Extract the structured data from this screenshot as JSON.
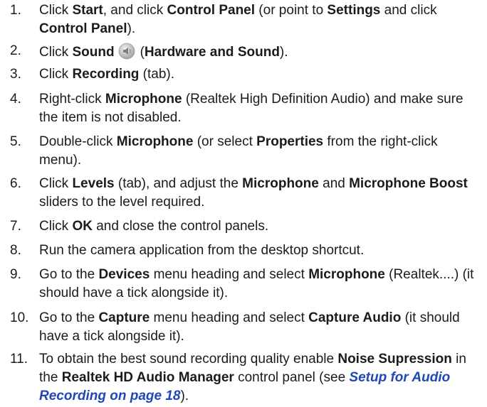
{
  "steps": [
    {
      "num": "1.",
      "parts": [
        {
          "t": "Click "
        },
        {
          "b": "Start"
        },
        {
          "t": ", and click "
        },
        {
          "b": "Control Panel"
        },
        {
          "t": " (or point to "
        },
        {
          "b": "Settings"
        },
        {
          "t": " and click "
        },
        {
          "b": "Control Panel"
        },
        {
          "t": ")."
        }
      ]
    },
    {
      "num": "2.",
      "parts": [
        {
          "t": "Click "
        },
        {
          "b": "Sound"
        },
        {
          "icon": "speaker-icon"
        },
        {
          "t": "("
        },
        {
          "b": "Hardware and Sound"
        },
        {
          "t": ")."
        }
      ]
    },
    {
      "num": "3.",
      "parts": [
        {
          "t": "Click "
        },
        {
          "b": "Recording"
        },
        {
          "t": " (tab)."
        }
      ]
    },
    {
      "num": "4.",
      "parts": [
        {
          "t": "Right-click "
        },
        {
          "b": "Microphone"
        },
        {
          "t": " (Realtek High Definition Audio) and make sure the item is not disabled."
        }
      ]
    },
    {
      "num": "5.",
      "parts": [
        {
          "t": "Double-click "
        },
        {
          "b": "Microphone"
        },
        {
          "t": " (or select "
        },
        {
          "b": "Properties"
        },
        {
          "t": " from the right-click menu)."
        }
      ]
    },
    {
      "num": "6.",
      "parts": [
        {
          "t": "Click "
        },
        {
          "b": "Levels"
        },
        {
          "t": " (tab), and adjust the "
        },
        {
          "b": "Microphone"
        },
        {
          "t": " and "
        },
        {
          "b": "Microphone Boost"
        },
        {
          "t": " sliders to the level required."
        }
      ]
    },
    {
      "num": "7.",
      "parts": [
        {
          "t": "Click "
        },
        {
          "b": "OK"
        },
        {
          "t": " and close the control panels."
        }
      ]
    },
    {
      "num": "8.",
      "parts": [
        {
          "t": "Run the camera application from the desktop shortcut."
        }
      ]
    },
    {
      "num": "9.",
      "parts": [
        {
          "t": "Go to the "
        },
        {
          "b": "Devices"
        },
        {
          "t": " menu heading and select "
        },
        {
          "b": "Microphone"
        },
        {
          "t": " (Realtek....) (it should have a tick alongside it)."
        }
      ]
    },
    {
      "num": "10.",
      "parts": [
        {
          "t": "Go to the "
        },
        {
          "b": "Capture"
        },
        {
          "t": " menu heading and select "
        },
        {
          "b": "Capture Audio"
        },
        {
          "t": " (it should have a tick alongside it)."
        }
      ]
    },
    {
      "num": "11.",
      "parts": [
        {
          "t": "To obtain the best sound recording quality enable "
        },
        {
          "b": "Noise Supression"
        },
        {
          "t": " in the "
        },
        {
          "b": "Realtek HD Audio Manager"
        },
        {
          "t": " control panel (see "
        },
        {
          "link": "Setup for Audio Recording on page 18"
        },
        {
          "t": ")."
        }
      ]
    }
  ],
  "colors": {
    "text": "#1b1b1b",
    "link": "#1f47b8"
  }
}
